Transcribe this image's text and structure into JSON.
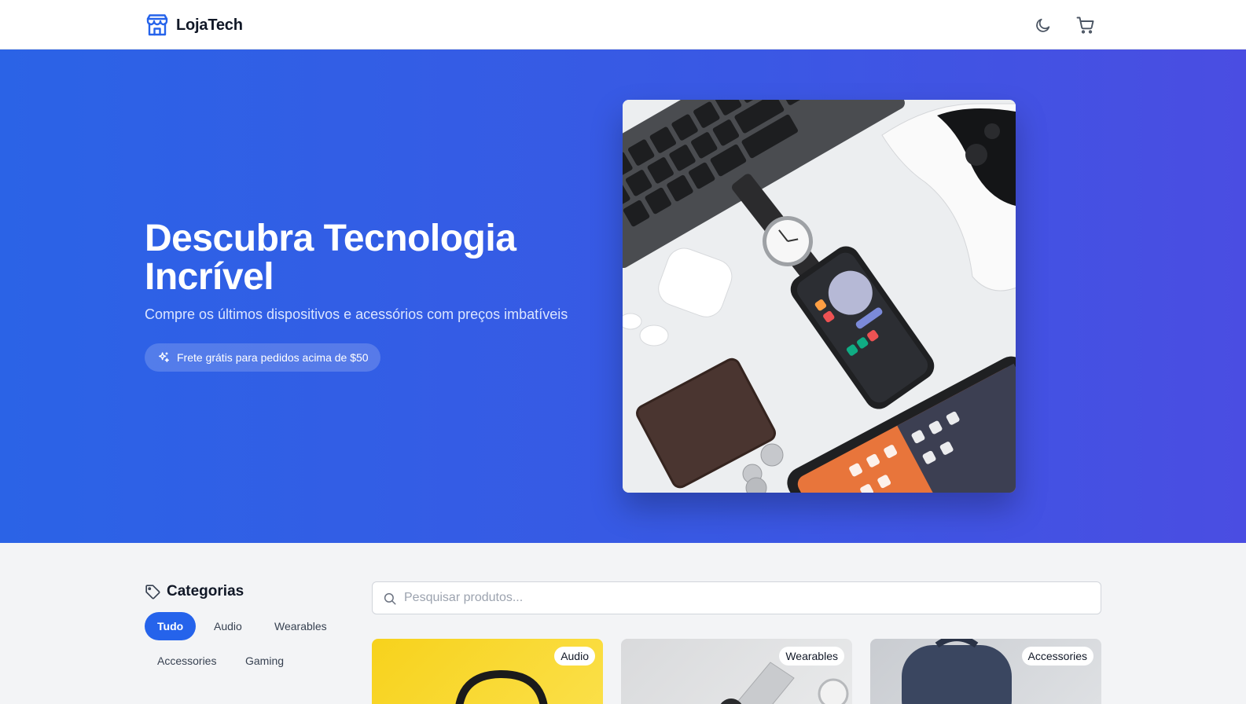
{
  "header": {
    "brand": "LojaTech",
    "icons": {
      "logo": "store-icon",
      "theme": "moon-icon",
      "cart": "cart-icon"
    }
  },
  "hero": {
    "title": "Descubra Tecnologia Incrível",
    "subtitle": "Compre os últimos dispositivos e acessórios com preços imbatíveis",
    "badge": "Frete grátis para pedidos acima de $50",
    "badge_icon": "sparkles-icon",
    "image": "tech-flatlay-photo"
  },
  "categories": {
    "title": "Categorias",
    "icon": "tag-icon",
    "items": [
      {
        "label": "Tudo",
        "active": true
      },
      {
        "label": "Audio",
        "active": false
      },
      {
        "label": "Wearables",
        "active": false
      },
      {
        "label": "Accessories",
        "active": false
      },
      {
        "label": "Gaming",
        "active": false
      }
    ]
  },
  "search": {
    "placeholder": "Pesquisar produtos..."
  },
  "products": [
    {
      "category": "Audio",
      "image": "headphones-photo"
    },
    {
      "category": "Wearables",
      "image": "smartwatch-photo"
    },
    {
      "category": "Accessories",
      "image": "backpack-photo"
    }
  ],
  "colors": {
    "primary": "#2563eb",
    "hero_start": "#2b63e6",
    "hero_end": "#4a4de2"
  }
}
